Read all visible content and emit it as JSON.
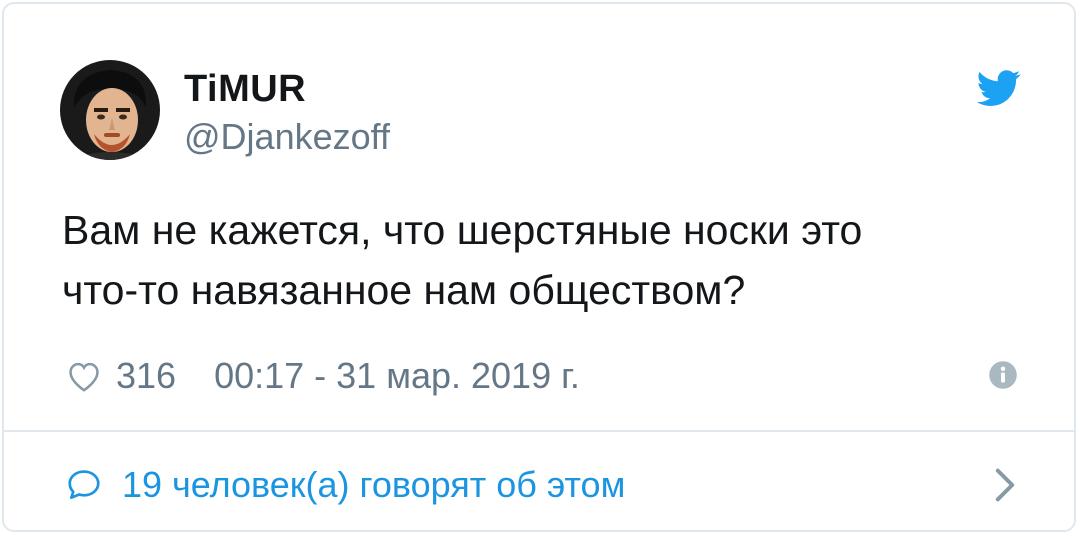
{
  "user": {
    "display_name": "TiMUR",
    "handle": "@Djankezoff",
    "avatar_icon": "avatar-portrait"
  },
  "tweet": {
    "text_line_1": "Вам не кажется, что шерстяные носки это",
    "text_line_2": "что-то навязанное нам обществом?"
  },
  "meta": {
    "likes": "316",
    "timestamp": "00:17 - 31 мар. 2019 г."
  },
  "footer": {
    "replies_text": "19 человек(а) говорят об этом"
  },
  "icons": {
    "brand": "twitter-bird-icon",
    "like": "heart-icon",
    "info": "info-icon",
    "reply": "speech-bubble-icon",
    "chevron": "chevron-right-icon"
  },
  "colors": {
    "text": "#14171a",
    "secondary": "#657786",
    "accent": "#1b95e0",
    "twitter_blue": "#1da1f2",
    "border": "#e1e8ed"
  }
}
